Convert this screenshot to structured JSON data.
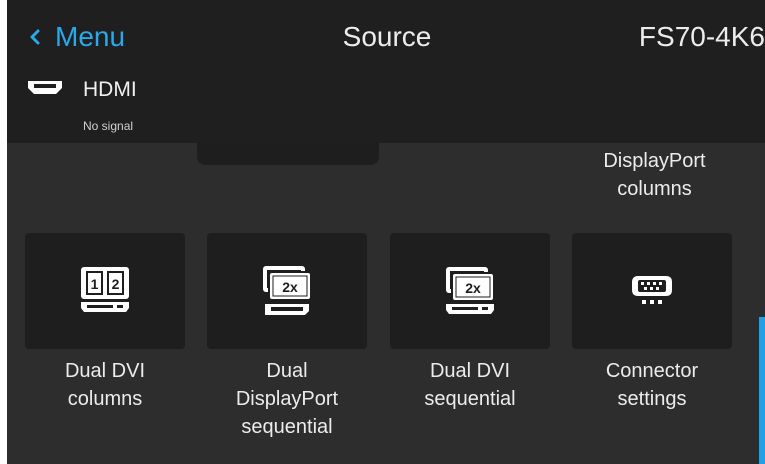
{
  "header": {
    "back_label": "Menu",
    "title": "Source",
    "device_name": "FS70-4K6"
  },
  "source": {
    "icon": "hdmi-icon",
    "name": "HDMI",
    "status": "No signal"
  },
  "partial_tile": {
    "label_line1": "DisplayPort",
    "label_line2": "columns"
  },
  "tiles": [
    {
      "icon": "dual-dvi-columns-icon",
      "label_lines": [
        "Dual DVI",
        "columns"
      ]
    },
    {
      "icon": "dual-displayport-sequential-icon",
      "label_lines": [
        "Dual",
        "DisplayPort",
        "sequential"
      ]
    },
    {
      "icon": "dual-dvi-sequential-icon",
      "label_lines": [
        "Dual DVI",
        "sequential"
      ]
    },
    {
      "icon": "connector-settings-icon",
      "label_lines": [
        "Connector",
        "settings"
      ]
    }
  ],
  "icon_text": {
    "one": "1",
    "two": "2",
    "two_x": "2x"
  },
  "colors": {
    "accent": "#2aa8ea",
    "header_bg": "#1f1f1f",
    "panel_bg": "#2d2d2d",
    "tile_bg": "#1e1e1e",
    "text": "#ececec"
  }
}
